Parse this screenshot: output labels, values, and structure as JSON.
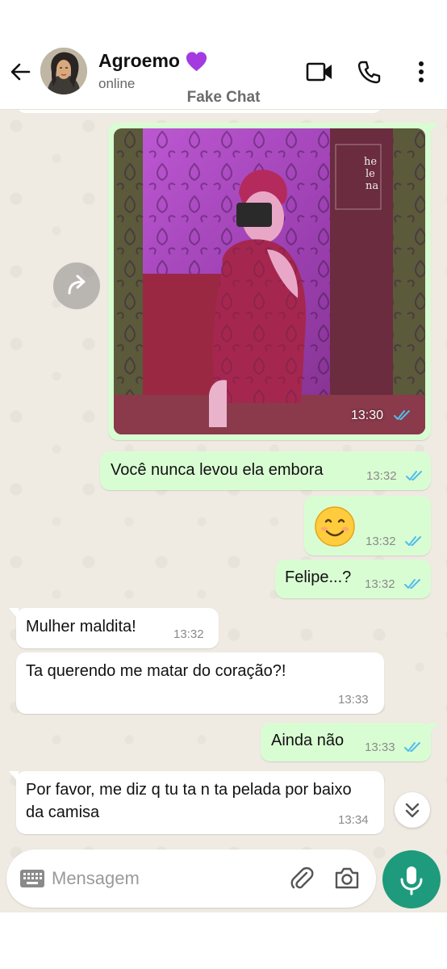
{
  "header": {
    "contact_name": "Agroemo",
    "status": "online",
    "watermark": "Fake Chat"
  },
  "input": {
    "placeholder": "Mensagem"
  },
  "colors": {
    "accent": "#1d9b7c",
    "outgoing_bubble": "#d9fdd3",
    "incoming_bubble": "#ffffff",
    "chat_background": "#efeae2",
    "read_check": "#53bdeb",
    "heart": "#a33be0"
  },
  "messages": [
    {
      "direction": "out",
      "type": "image",
      "time": "13:30",
      "status": "read"
    },
    {
      "direction": "out",
      "type": "text",
      "text": "Você nunca levou ela embora",
      "time": "13:32",
      "status": "read"
    },
    {
      "direction": "out",
      "type": "emoji",
      "text": "😊",
      "time": "13:32",
      "status": "read"
    },
    {
      "direction": "out",
      "type": "text",
      "text": "Felipe...?",
      "time": "13:32",
      "status": "read"
    },
    {
      "direction": "in",
      "type": "text",
      "text": "Mulher maldita!",
      "time": "13:32"
    },
    {
      "direction": "in",
      "type": "text",
      "text": "Ta querendo me matar do coração?!",
      "time": "13:33"
    },
    {
      "direction": "out",
      "type": "text",
      "text": "Ainda não",
      "time": "13:33",
      "status": "read"
    },
    {
      "direction": "in",
      "type": "text",
      "text": "Por favor, me diz q tu ta n ta pelada por baixo da camisa",
      "time": "13:34"
    }
  ],
  "icons": {
    "back": "arrow-left",
    "heart": "purple-heart",
    "video": "video-camera",
    "call": "phone",
    "more": "vertical-dots",
    "forward": "forward-arrow",
    "scroll": "double-chevron-down",
    "keyboard": "keyboard",
    "attach": "paperclip",
    "camera": "camera",
    "mic": "microphone"
  }
}
